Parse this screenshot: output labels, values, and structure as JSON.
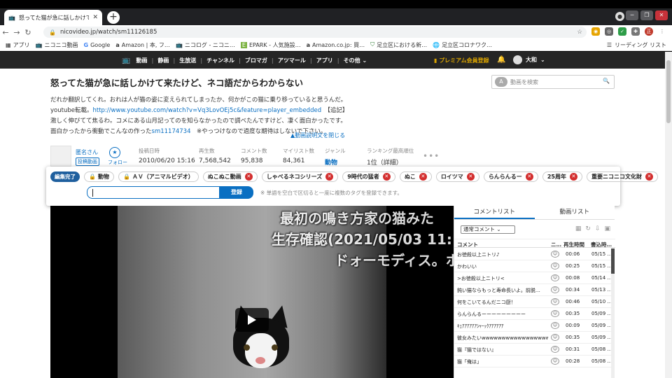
{
  "browser": {
    "tab_title": "怒ってた猫が急に話しかけて来たけど、ネコ語だからわからない",
    "url": "nicovideo.jp/watch/sm11126185",
    "profile_initials": "正人",
    "bookmarks": [
      {
        "label": "アプリ",
        "icon": "apps-grid-icon"
      },
      {
        "label": "ニコニコ動画",
        "icon": "tv-icon"
      },
      {
        "label": "Google",
        "icon": "google-icon"
      },
      {
        "label": "Amazon | 本, フ…",
        "icon": "amazon-icon"
      },
      {
        "label": "ニコログ - ニコニ…",
        "icon": "tv-icon"
      },
      {
        "label": "EPARK - 人気施設…",
        "icon": "epark-icon"
      },
      {
        "label": "Amazon.co.jp: 買…",
        "icon": "amazon-icon"
      },
      {
        "label": "足立区における新…",
        "icon": "adachi-icon"
      },
      {
        "label": "足立区コロナワク…",
        "icon": "globe-icon"
      }
    ],
    "reading_list": "リーディング リスト"
  },
  "niconav": {
    "items": [
      "動画",
      "静画",
      "生放送",
      "チャンネル",
      "ブロマガ",
      "アツマール",
      "アプリ",
      "その他"
    ],
    "premium": "プレミアム会員登録",
    "username": "大和"
  },
  "video": {
    "title": "怒ってた猫が急に話しかけて来たけど、ネコ語だからわからない",
    "search_placeholder": "動画を検索",
    "desc_line1": "だれか翻訳してくれ。おれは人が猫の姿に変えられてしまったか、何かがこの猫に乗り移っていると思うんだ。",
    "desc_line2_prefix": "youtube転載。",
    "desc_link": "http://www.youtube.com/watch?v=Vq3LovOEj5c&feature=player_embedded",
    "desc_line2_suffix": "【追記】",
    "desc_line3": "激しく伸びてて焦るわ。コメにある山月記ってのを知らなかったので調べたんですけど、凄く面白かったです。",
    "desc_line4_prefix": "面白かったから衝動でこんなの作った",
    "desc_line4_link": "sm11174734",
    "desc_line4_suffix": "※やっつけなので過度な期待はしないで下さい。",
    "close_desc": "▲動画説明文を閉じる",
    "uploader": "匿名さん",
    "uploader_tag": "投稿動画",
    "follow": "フォロー",
    "stats": [
      {
        "label": "投稿日時",
        "value": "2010/06/20 15:16"
      },
      {
        "label": "再生数",
        "value": "7,568,542"
      },
      {
        "label": "コメント数",
        "value": "95,838"
      },
      {
        "label": "マイリスト数",
        "value": "84,361"
      },
      {
        "label": "ジャンル",
        "value": "動物"
      },
      {
        "label": "ランキング最高順位",
        "value": "1位（詳細）"
      }
    ]
  },
  "tags": {
    "edit_done": "編集完了",
    "items": [
      "動物",
      "ＡＶ（アニマルビデオ）",
      "ぬこぬこ動画",
      "しゃべるネコシリーズ",
      "9時代の猛者",
      "ぬこ",
      "ロイツマ",
      "らんらんるー",
      "25周年",
      "重要ニコニコ文化財"
    ],
    "input_value": "",
    "register": "登録",
    "hint": "※ 単語を空白で区切ると一度に複数のタグを登録できます。"
  },
  "player": {
    "overlay_comments": [
      "最初の鳴き方家の猫みた",
      "生存確認(2021/05/03 11:1",
      "ドォーモディス。ホ"
    ]
  },
  "comments": {
    "tab_comments": "コメントリスト",
    "tab_videos": "動画リスト",
    "filter": "通常コメント",
    "col_comment": "コメント",
    "col_nico": "ニ…",
    "col_time": "再生時間",
    "col_date": "書込時…",
    "rows": [
      {
        "text": "お徳殺以上ニトリ♪",
        "time": "00:06",
        "date": "05/15 …"
      },
      {
        "text": "かわいい",
        "time": "00:25",
        "date": "05/15 …"
      },
      {
        "text": ">お徳殺以上ニトリ<",
        "time": "00:08",
        "date": "05/14 …"
      },
      {
        "text": "鈍い猫ならもっと寿命長いよ。前脱…",
        "time": "00:34",
        "date": "05/13 …"
      },
      {
        "text": "何をこいてるんだニコ厨！",
        "time": "00:46",
        "date": "05/10 …"
      },
      {
        "text": "らんらんるーーーーーーーーー",
        "time": "00:35",
        "date": "05/09 …"
      },
      {
        "text": "ｷｪｱｱｱｱｱｱｼｬｰｯｸｱｱｱｱｱｱ",
        "time": "00:09",
        "date": "05/09 …"
      },
      {
        "text": "彼女みたいwwwwwwwwwwwwwwwwww…",
        "time": "00:35",
        "date": "05/09 …"
      },
      {
        "text": "猫『猫ではない』",
        "time": "00:31",
        "date": "05/08 …"
      },
      {
        "text": "猫「俺は」",
        "time": "00:28",
        "date": "05/08 …"
      }
    ]
  }
}
